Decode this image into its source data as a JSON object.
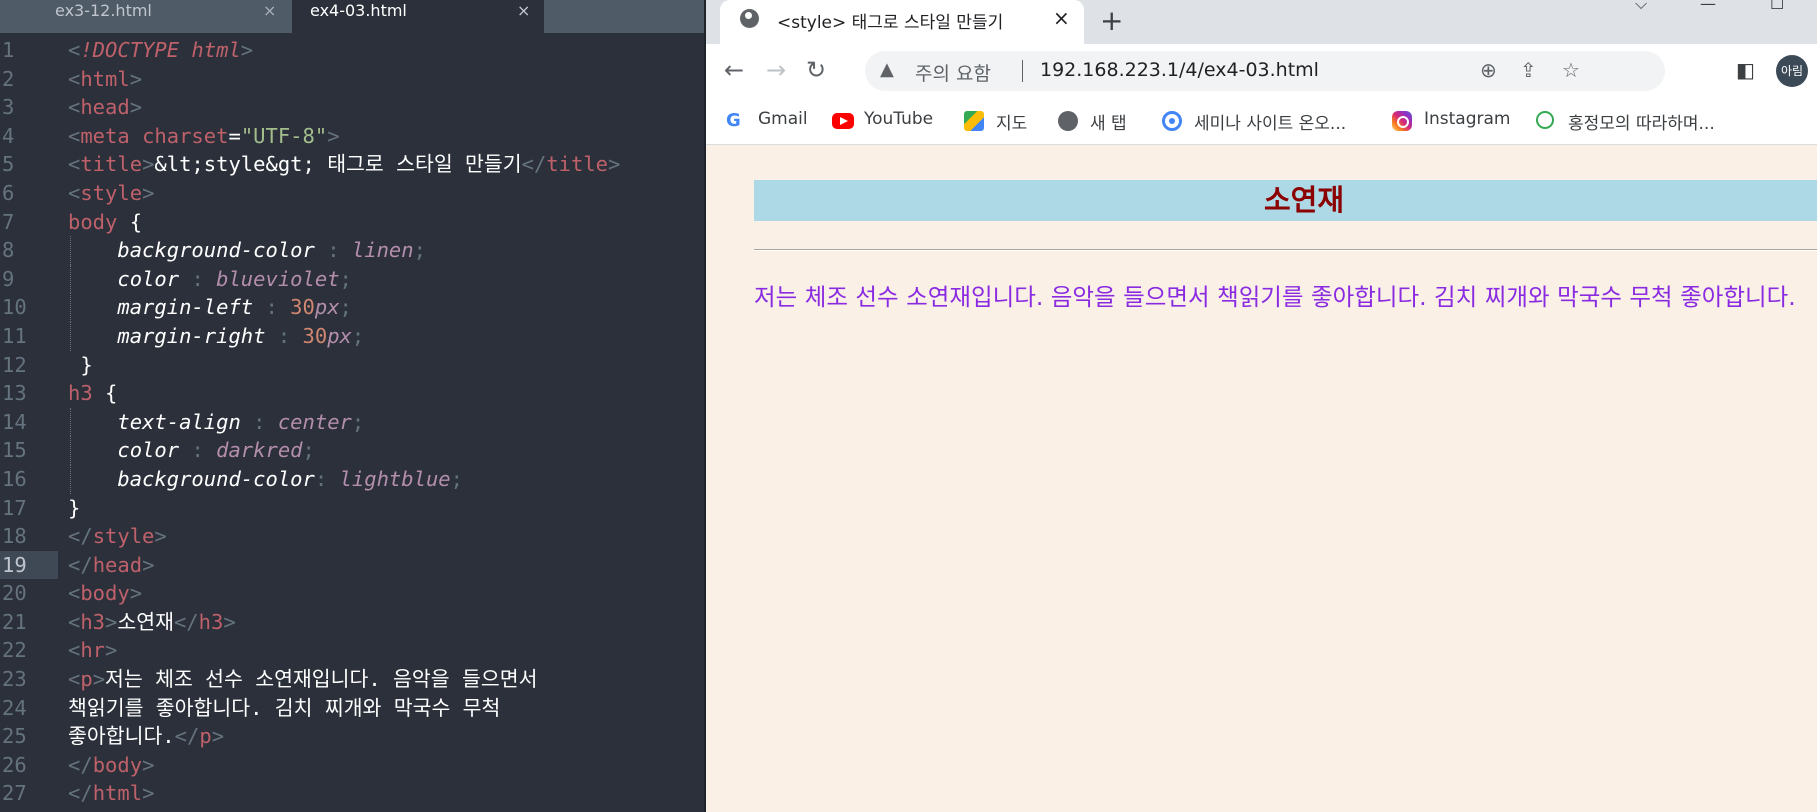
{
  "editor": {
    "tabs": [
      {
        "name": "ex3-12.html",
        "close": "×"
      },
      {
        "name": "ex4-03.html",
        "close": "×"
      }
    ],
    "play": "▶",
    "line_numbers": [
      "1",
      "2",
      "3",
      "4",
      "5",
      "6",
      "7",
      "8",
      "9",
      "10",
      "11",
      "12",
      "13",
      "14",
      "15",
      "16",
      "17",
      "18",
      "19",
      "20",
      "21",
      "22",
      "23",
      "24",
      "25",
      "26",
      "27"
    ]
  },
  "browser": {
    "tab_title": "<style> 태그로 스타일 만들기",
    "tab_close": "×",
    "new_tab": "+",
    "security_warning": "주의 요함",
    "url": "192.168.223.1/4/ex4-03.html",
    "profile": "아림",
    "bookmarks": [
      {
        "label": "Gmail",
        "icon": "google-icon"
      },
      {
        "label": "YouTube",
        "icon": "youtube-icon"
      },
      {
        "label": "지도",
        "icon": "maps-icon"
      },
      {
        "label": "새 탭",
        "icon": "globe-icon"
      },
      {
        "label": "세미나 사이트 온오...",
        "icon": "seminar-icon"
      },
      {
        "label": "Instagram",
        "icon": "instagram-icon"
      },
      {
        "label": "홍정모의 따라하며...",
        "icon": "green-leaf-icon"
      }
    ],
    "page": {
      "heading": "소연재",
      "paragraph": "저는 체조 선수 소연재입니다. 음악을 들으면서 책읽기를 좋아합니다. 김치 찌개와 막국수 무척 좋아합니다."
    }
  }
}
